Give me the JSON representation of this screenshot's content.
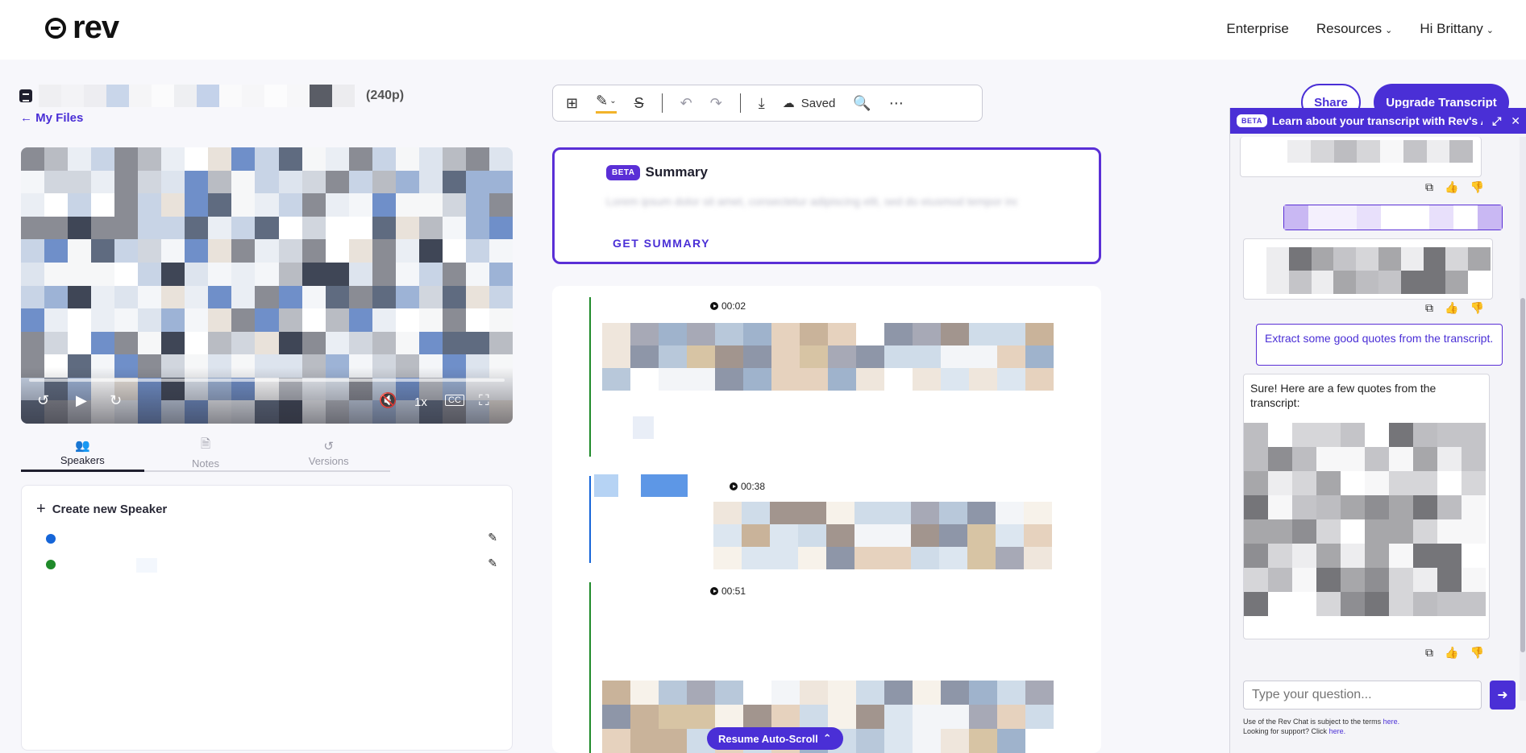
{
  "header": {
    "logo_text": "rev",
    "nav": [
      {
        "label": "Enterprise",
        "has_chevron": false
      },
      {
        "label": "Resources",
        "has_chevron": true
      },
      {
        "label": "Hi Brittany",
        "has_chevron": true
      }
    ]
  },
  "file": {
    "quality": "(240p)",
    "back_label": "← My Files"
  },
  "player": {
    "speed": "1x",
    "cc": "CC"
  },
  "left_tabs": [
    {
      "label": "Speakers",
      "icon": "people-icon",
      "active": true
    },
    {
      "label": "Notes",
      "icon": "notes-icon",
      "active": false
    },
    {
      "label": "Versions",
      "icon": "history-icon",
      "active": false
    }
  ],
  "speakers": {
    "create_label": "Create new Speaker",
    "items": [
      {
        "color": "#1565d8"
      },
      {
        "color": "#1f8a2a"
      }
    ]
  },
  "toolbar": {
    "saved_label": "Saved"
  },
  "summary": {
    "badge": "BETA",
    "title": "Summary",
    "placeholder_text": "Lorem ipsum dolor sit amet, consectetur adipiscing elit, sed do eiusmod tempor incididunt ut labore et dolore magna aliqua. Ut enim ad minim",
    "cta": "GET SUMMARY"
  },
  "transcript": {
    "segments": [
      {
        "timestamp": "00:02",
        "line_color": "#1f8a2a"
      },
      {
        "timestamp": "00:38",
        "line_color": "#1565d8"
      },
      {
        "timestamp": "00:51",
        "line_color": "#1f8a2a"
      }
    ],
    "resume_label": "Resume Auto-Scroll"
  },
  "actions": {
    "share": "Share",
    "upgrade": "Upgrade Transcript"
  },
  "ai_chat": {
    "badge": "BETA",
    "title": "Learn about your transcript with Rev's AI",
    "user_message": "Extract some good quotes from the transcript.",
    "assistant_intro": "Sure! Here are a few quotes from the transcript:",
    "input_placeholder": "Type your question...",
    "fineprint_1": "Use of the Rev Chat is subject to the terms ",
    "fineprint_link_1": "here.",
    "fineprint_2": "Looking for support? Click ",
    "fineprint_link_2": "here."
  },
  "colors": {
    "accent": "#4a2fd6",
    "highlight": "#f2b32a"
  }
}
